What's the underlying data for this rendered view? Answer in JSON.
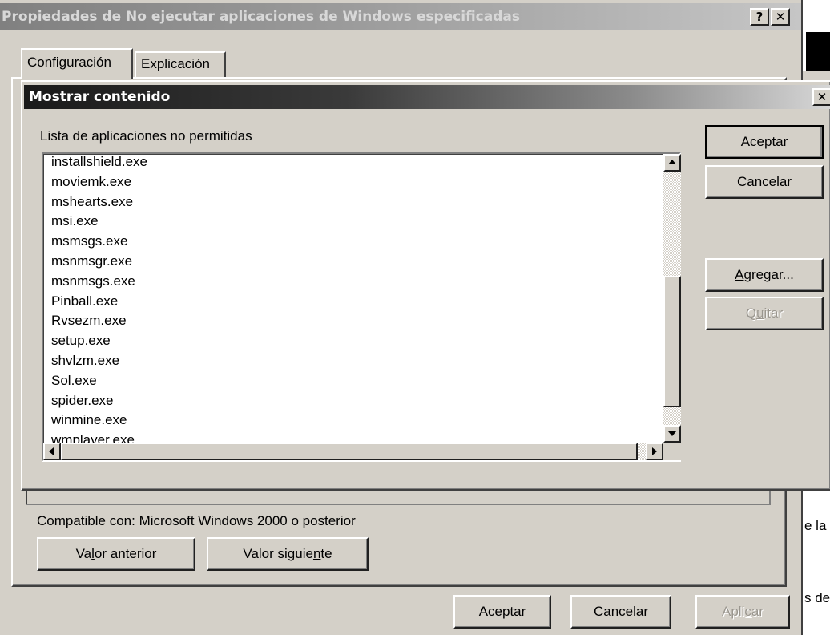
{
  "outer_dialog": {
    "title": "Propiedades de No ejecutar aplicaciones de Windows especificadas",
    "help_button": "?",
    "close_button": "✕",
    "tabs": [
      {
        "label": "Configuración"
      },
      {
        "label": "Explicación"
      }
    ],
    "compat_text": "Compatible con: Microsoft Windows 2000 o posterior",
    "prev_button": {
      "before": "Va",
      "key": "l",
      "after": "or anterior"
    },
    "next_button": {
      "before": "Valor siguie",
      "key": "n",
      "after": "te"
    },
    "ok_button": "Aceptar",
    "cancel_button": "Cancelar",
    "apply_button": {
      "before": "Apli",
      "key": "c",
      "after": "ar"
    }
  },
  "inner_dialog": {
    "title": "Mostrar contenido",
    "close_button": "✕",
    "list_label": "Lista de aplicaciones no permitidas",
    "items": [
      "installshield.exe",
      "moviemk.exe",
      "mshearts.exe",
      "msi.exe",
      "msmsgs.exe",
      "msnmsgr.exe",
      "msnmsgs.exe",
      "Pinball.exe",
      "Rvsezm.exe",
      "setup.exe",
      "shvlzm.exe",
      "Sol.exe",
      "spider.exe",
      "winmine.exe",
      "wmplayer.exe"
    ],
    "ok_button": "Aceptar",
    "cancel_button": "Cancelar",
    "add_button": {
      "key": "A",
      "after": "gregar..."
    },
    "remove_button": {
      "before": "Q",
      "key": "u",
      "after": "itar"
    }
  },
  "background_window": {
    "fragment_1": "e la",
    "fragment_2": "s de"
  },
  "colors": {
    "face": "#d4d0c8",
    "active_title_start": "#0a246a",
    "active_title_end": "#a6caf0",
    "inactive_title_start": "#808080",
    "inactive_title_end": "#c0c0c0"
  }
}
